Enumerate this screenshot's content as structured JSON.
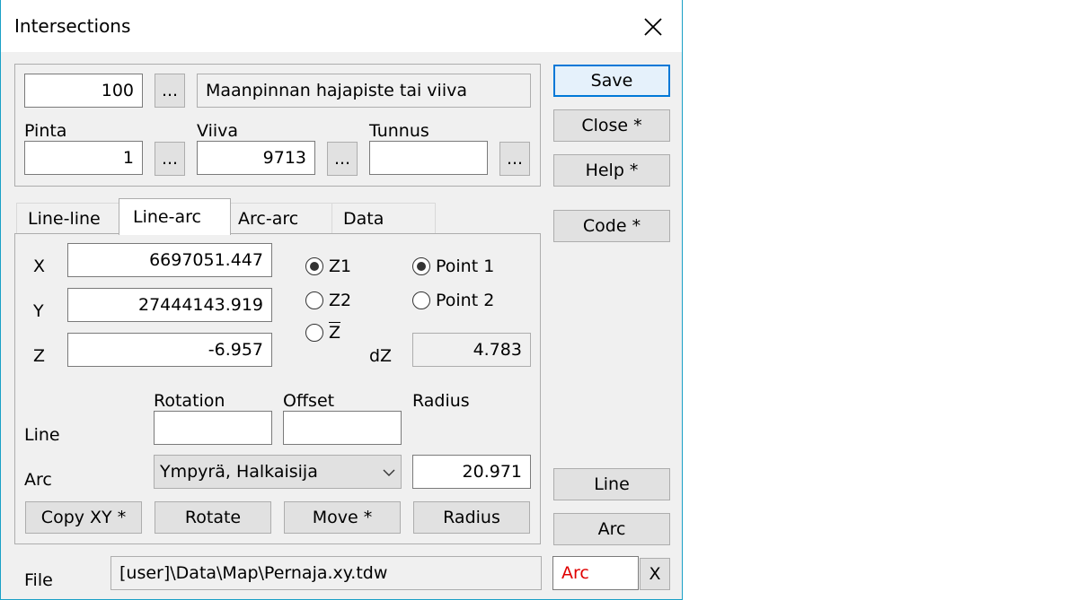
{
  "window": {
    "title": "Intersections",
    "close_glyph": "✕"
  },
  "top": {
    "code_value": "100",
    "browse_label": "...",
    "description": "Maanpinnan hajapiste tai viiva",
    "pinta_label": "Pinta",
    "pinta_value": "1",
    "viiva_label": "Viiva",
    "viiva_value": "9713",
    "tunnus_label": "Tunnus",
    "tunnus_value": ""
  },
  "side_buttons": {
    "save": "Save",
    "close": "Close *",
    "help": "Help *",
    "code": "Code *",
    "line": "Line",
    "arc": "Arc"
  },
  "tabs": [
    "Line-line",
    "Line-arc",
    "Arc-arc",
    "Data"
  ],
  "active_tab": "Line-arc",
  "coords": {
    "x_label": "X",
    "x_value": "6697051.447",
    "y_label": "Y",
    "y_value": "27444143.919",
    "z_label": "Z",
    "z_value": "-6.957"
  },
  "z_options": [
    {
      "label": "Z1",
      "checked": true
    },
    {
      "label": "Z2",
      "checked": false
    },
    {
      "label": "Z",
      "checked": false
    }
  ],
  "point_options": [
    {
      "label": "Point 1",
      "checked": true
    },
    {
      "label": "Point 2",
      "checked": false
    }
  ],
  "dz": {
    "label": "dZ",
    "value": "4.783"
  },
  "params": {
    "rotation_label": "Rotation",
    "offset_label": "Offset",
    "radius_label": "Radius",
    "line_label": "Line",
    "arc_label": "Arc",
    "rotation_value": "",
    "offset_value": "",
    "arc_type": "Ympyrä, Halkaisija",
    "radius_value": "20.971"
  },
  "actions": {
    "copy_xy": "Copy XY *",
    "rotate": "Rotate",
    "move": "Move *",
    "radius": "Radius"
  },
  "file": {
    "label": "File",
    "path": "[user]\\Data\\Map\\Pernaja.xy.tdw",
    "mode": "Arc",
    "clear": "X"
  },
  "colors": {
    "accent": "#0078d7",
    "border": "#1aa0c6",
    "mode_text": "#e00000"
  },
  "icons": {
    "close": "close-icon",
    "dropdown": "chevron-down-icon"
  }
}
